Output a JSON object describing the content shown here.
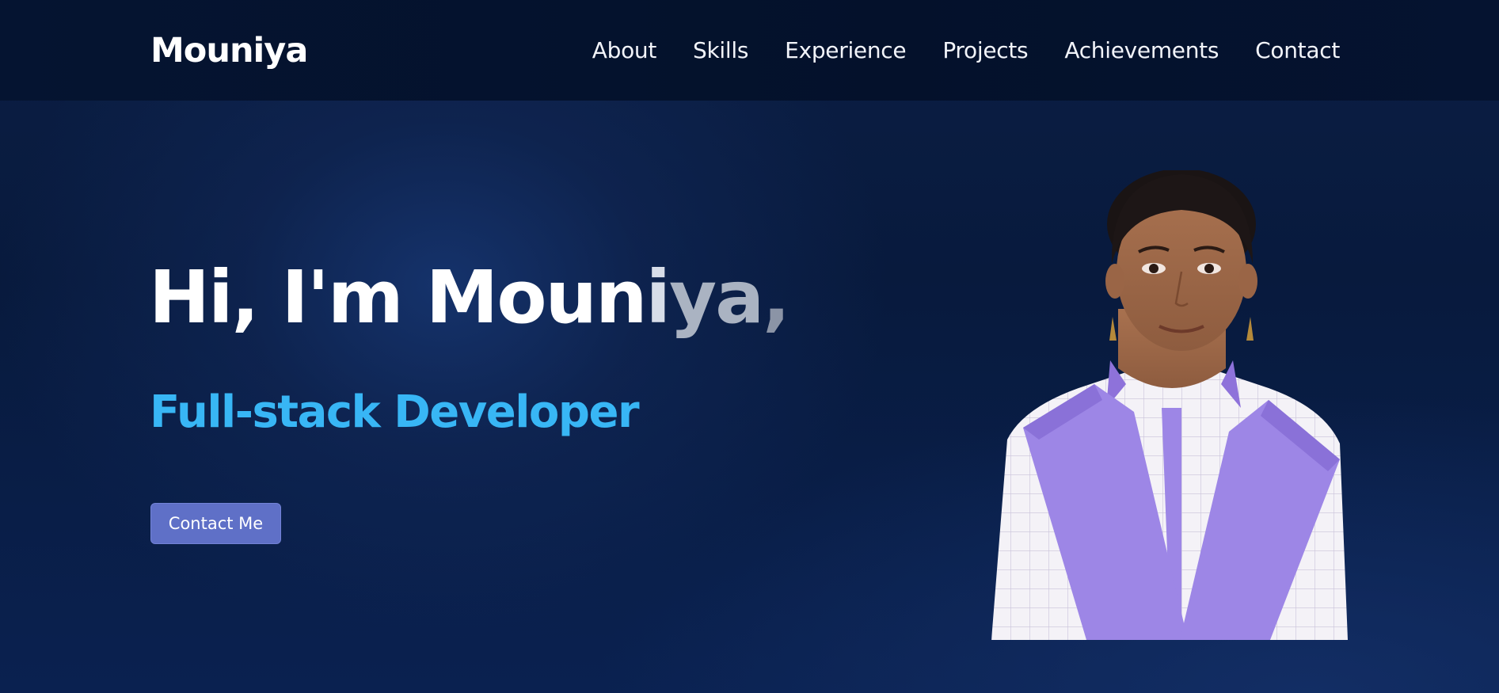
{
  "navbar": {
    "logo": "Mouniya",
    "links": [
      "About",
      "Skills",
      "Experience",
      "Projects",
      "Achievements",
      "Contact"
    ]
  },
  "hero": {
    "greeting_main": "Hi, I'm Moun",
    "greeting_fade1": "i",
    "greeting_fade2": "ya",
    "greeting_fade3": ",",
    "subtitle": "Full-stack Developer",
    "cta_label": "Contact Me"
  },
  "colors": {
    "background": "#061633",
    "navbar": "#04112b",
    "subtitle": "#38b6f5",
    "cta": "#5f70c7",
    "dupatta": "#9d86e6"
  },
  "images": {
    "portrait": "profile-photo"
  }
}
